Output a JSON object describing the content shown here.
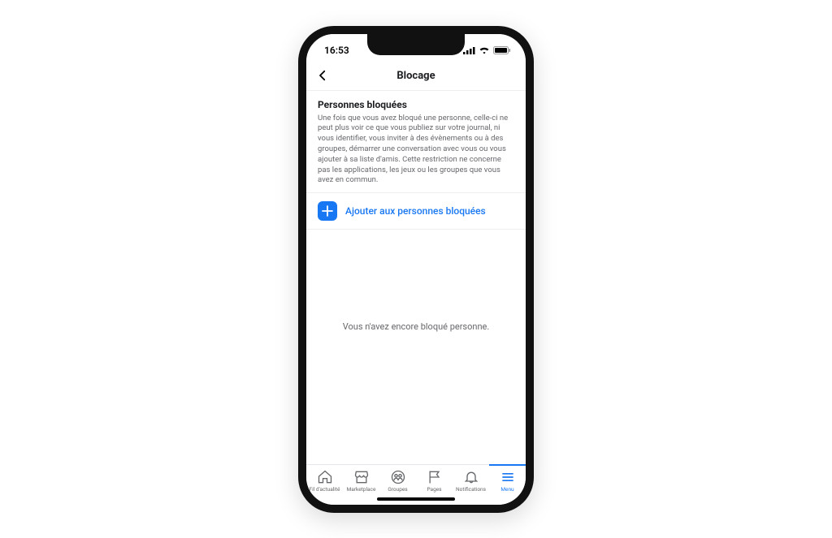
{
  "status": {
    "time": "16:53"
  },
  "header": {
    "title": "Blocage"
  },
  "section": {
    "title": "Personnes bloquées",
    "description": "Une fois que vous avez bloqué une personne, celle-ci ne peut plus voir ce que vous publiez sur votre journal, ni vous identifier, vous inviter à des évènements ou à des groupes, démarrer une conversation avec vous ou vous ajouter à sa liste d'amis. Cette restriction ne concerne pas les applications, les jeux ou les groupes que vous avez en commun."
  },
  "add_action": {
    "label": "Ajouter aux personnes bloquées"
  },
  "empty": {
    "message": "Vous n'avez encore bloqué personne."
  },
  "tabs": [
    {
      "label": "Fil d'actualité"
    },
    {
      "label": "Marketplace"
    },
    {
      "label": "Groupes"
    },
    {
      "label": "Pages"
    },
    {
      "label": "Notifications"
    },
    {
      "label": "Menu"
    }
  ],
  "colors": {
    "accent": "#1877f2",
    "muted": "#65676b"
  }
}
